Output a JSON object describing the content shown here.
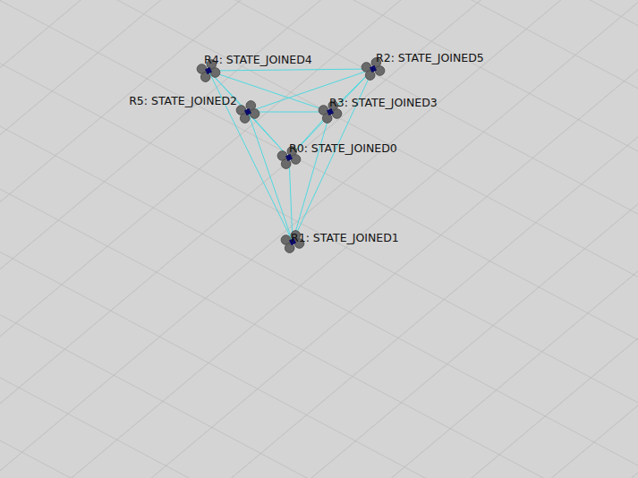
{
  "robots": [
    {
      "label": "R0: STATE_JOINED0"
    },
    {
      "label": "R1: STATE_JOINED1"
    },
    {
      "label": "R2: STATE_JOINED5"
    },
    {
      "label": "R3: STATE_JOINED3"
    },
    {
      "label": "R4: STATE_JOINED4"
    },
    {
      "label": "R5: STATE_JOINED2"
    }
  ],
  "links": [
    [
      0,
      1
    ],
    [
      0,
      2
    ],
    [
      0,
      3
    ],
    [
      0,
      4
    ],
    [
      0,
      5
    ],
    [
      1,
      2
    ],
    [
      1,
      3
    ],
    [
      1,
      4
    ],
    [
      1,
      5
    ],
    [
      2,
      3
    ],
    [
      2,
      4
    ],
    [
      2,
      5
    ],
    [
      3,
      4
    ],
    [
      3,
      5
    ],
    [
      4,
      5
    ]
  ]
}
